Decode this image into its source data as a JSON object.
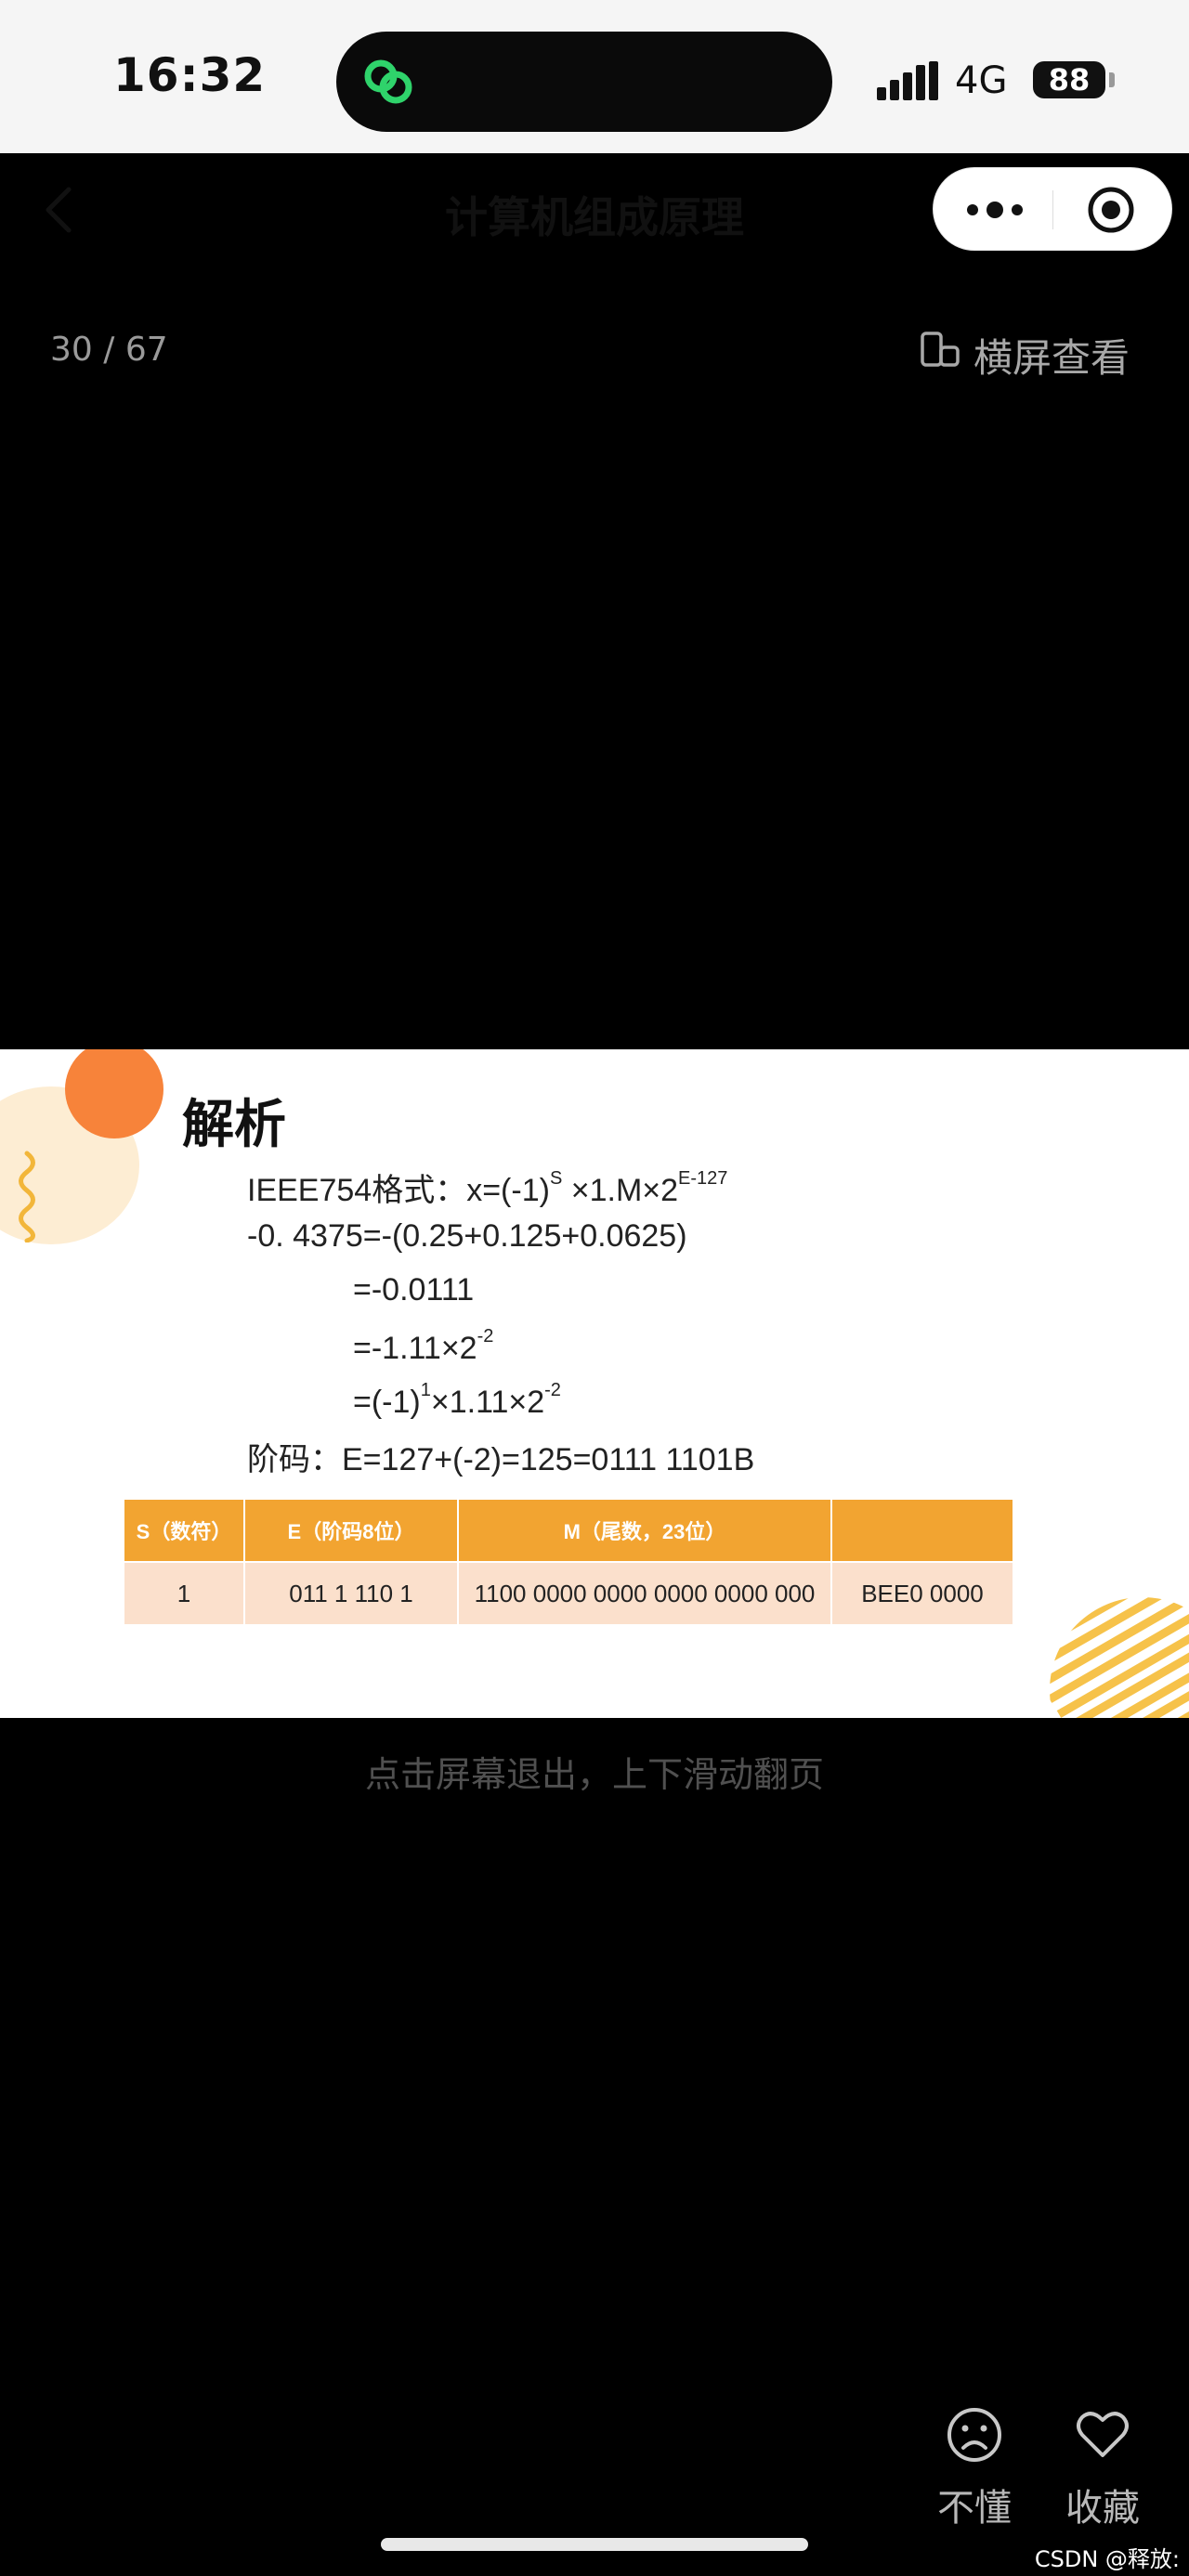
{
  "status_bar": {
    "time": "16:32",
    "network": "4G",
    "battery": "88",
    "app_icon": "mini-program-link-icon"
  },
  "nav": {
    "title": "计算机组成原理",
    "back_icon": "chevron-left-icon",
    "more_icon": "more-dots-icon",
    "close_icon": "target-circle-icon"
  },
  "viewer": {
    "page_counter": "30 / 67",
    "landscape_label": "横屏查看",
    "landscape_icon": "rotate-phone-icon",
    "hint": "点击屏幕退出，上下滑动翻页"
  },
  "slide": {
    "title": "解析",
    "lines": {
      "l1_text": "IEEE754格式：x=(-1)",
      "l1_sup1": "S",
      "l1_mid": " ×1.M×2",
      "l1_sup2": "E-127",
      "l2": "-0. 4375=-(0.25+0.125+0.0625)",
      "l3": "=-0.0111",
      "l4_text": "=-1.11×2",
      "l4_sup": "-2",
      "l5_a": "=(-1)",
      "l5_sup1": "1",
      "l5_b": "×1.11×2",
      "l5_sup2": "-2",
      "l6": "阶码：E=127+(-2)=125=0111 1101B"
    },
    "table": {
      "headers": [
        "S（数符）",
        "E（阶码8位）",
        "M（尾数，23位）",
        ""
      ],
      "row": [
        "1",
        "011 1 110 1",
        "1100 0000 0000 0000 0000 000",
        "BEE0 0000"
      ]
    },
    "colors": {
      "header": "#f2a431",
      "cell": "#fbe0cc",
      "accent": "#f7833a"
    }
  },
  "actions": {
    "dont_understand_label": "不懂",
    "dont_understand_icon": "sad-face-icon",
    "favorite_label": "收藏",
    "favorite_icon": "heart-icon"
  },
  "watermark": "CSDN @释放:"
}
